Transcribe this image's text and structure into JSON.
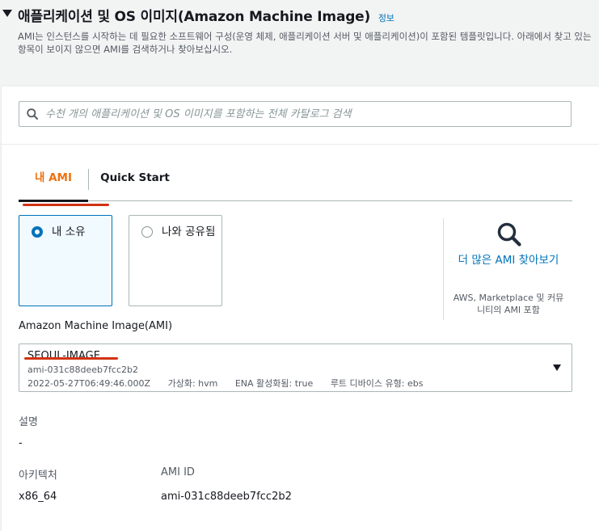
{
  "header": {
    "title": "애플리케이션 및 OS 이미지(Amazon Machine Image)",
    "info_link": "정보",
    "description": "AMI는 인스턴스를 시작하는 데 필요한 소프트웨어 구성(운영 체제, 애플리케이션 서버 및 애플리케이션)이 포함된 템플릿입니다. 아래에서 찾고 있는 항목이 보이지 않으면 AMI를 검색하거나 찾아보십시오."
  },
  "search": {
    "placeholder": "수천 개의 애플리케이션 및 OS 이미지를 포함하는 전체 카탈로그 검색",
    "value": ""
  },
  "tabs": [
    {
      "label": "내 AMI",
      "active": true
    },
    {
      "label": "Quick Start",
      "active": false
    }
  ],
  "ownership": {
    "options": [
      {
        "label": "내 소유",
        "selected": true
      },
      {
        "label": "나와 공유됨",
        "selected": false
      }
    ]
  },
  "browse_more": {
    "icon": "search-icon",
    "link": "더 많은 AMI 찾아보기",
    "note": "AWS, Marketplace 및 커뮤니티의 AMI 포함"
  },
  "ami": {
    "label": "Amazon Machine Image(AMI)",
    "selected_name": "SEOUL-IMAGE",
    "selected_id": "ami-031c88deeb7fcc2b2",
    "created": "2022-05-27T06:49:46.000Z",
    "virtualization": "가상화: hvm",
    "ena": "ENA 활성화됨: true",
    "root_device": "루트 디바이스 유형: ebs"
  },
  "details": {
    "description_label": "설명",
    "description_value": "-",
    "arch_label": "아키텍처",
    "arch_value": "x86_64",
    "ami_id_label": "AMI ID",
    "ami_id_value": "ami-031c88deeb7fcc2b2"
  },
  "colors": {
    "accent_orange": "#ec7211",
    "link_blue": "#0073bb",
    "annotation_red": "#d13212"
  }
}
